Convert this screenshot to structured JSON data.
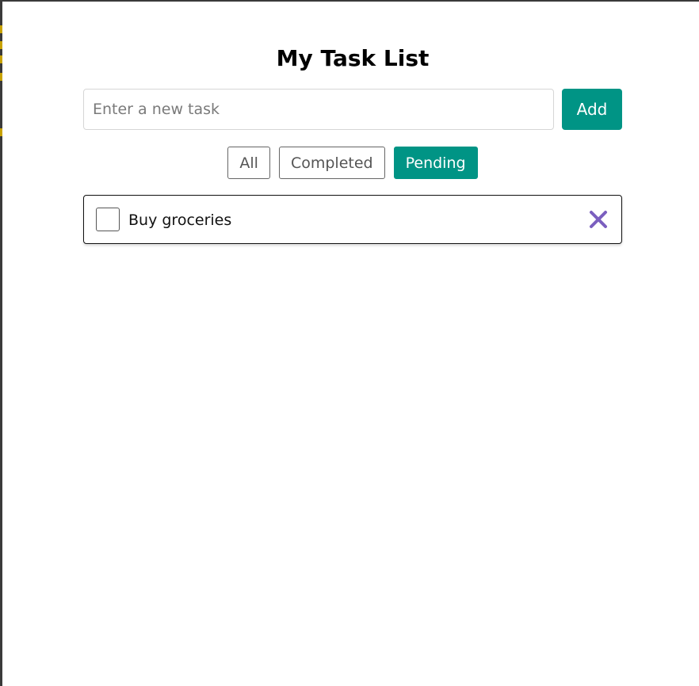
{
  "header": {
    "title": "My Task List"
  },
  "add_task": {
    "placeholder": "Enter a new task",
    "value": "",
    "add_label": "Add"
  },
  "filters": {
    "all_label": "All",
    "completed_label": "Completed",
    "pending_label": "Pending",
    "active": "Pending"
  },
  "tasks": [
    {
      "text": "Buy groceries",
      "completed": false,
      "delete_icon": "close-icon"
    }
  ],
  "colors": {
    "accent": "#009485",
    "delete_icon": "#7b5fbf",
    "edge_marker": "#c8a200"
  }
}
